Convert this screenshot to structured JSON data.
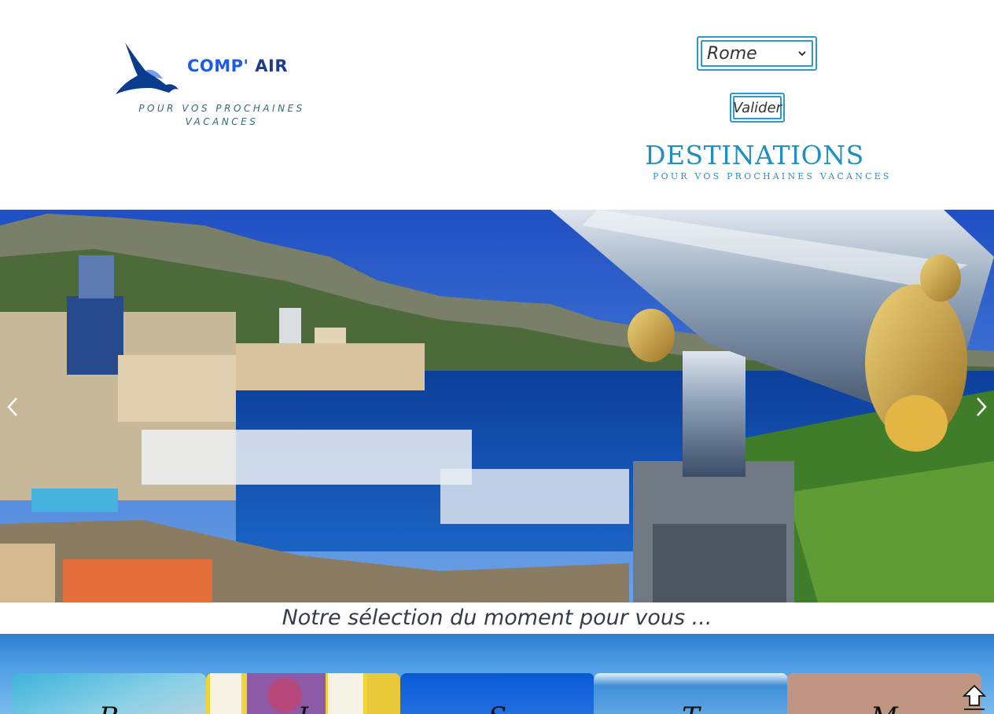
{
  "header": {
    "brand_part1": "COMP'",
    "brand_part2": " AIR",
    "tagline": "POUR VOS PROCHAINES VACANCES",
    "logo_icon": "bird-icon"
  },
  "search": {
    "selected_destination": "Rome",
    "submit_label": "Valider"
  },
  "destinations": {
    "title": "DESTINATIONS",
    "subtitle": "POUR VOS PROCHAINES VACANCES"
  },
  "carousel": {
    "image": "monaco-harbour-telescope",
    "prev_icon": "chevron-left-icon",
    "next_icon": "chevron-right-icon"
  },
  "selection": {
    "heading": "Notre sélection du moment pour vous ..."
  },
  "cards": [
    {
      "label": "R",
      "theme": "beach-sky"
    },
    {
      "label": "I",
      "theme": "india-ornate"
    },
    {
      "label": "S",
      "theme": "ocean-blue"
    },
    {
      "label": "T",
      "theme": "sky-clouds"
    },
    {
      "label": "M",
      "theme": "terracotta"
    }
  ],
  "colors": {
    "accent": "#2b9ac9",
    "brand_blue": "#1f5be3",
    "brand_dark": "#1f3c8a"
  },
  "scroll_top_icon": "arrow-up-icon"
}
